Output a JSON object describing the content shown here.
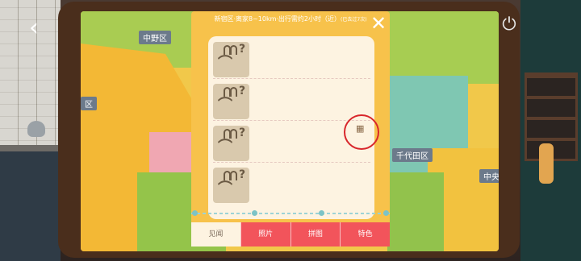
{
  "map": {
    "labels": [
      "中野区",
      "区",
      "千代田区",
      "中央"
    ]
  },
  "dialog": {
    "title": "新宿区·离家8~10km·出行需约2小时（近）",
    "title_note": "(已去过7次)",
    "close_glyph": "✕",
    "entries": [
      {
        "question": "?"
      },
      {
        "question": "?"
      },
      {
        "question": "?"
      },
      {
        "question": "?"
      }
    ],
    "tabs": [
      "见闻",
      "照片",
      "拼图",
      "特色"
    ]
  },
  "nav": {
    "back_glyph": "‹",
    "power_glyph": "⏻"
  },
  "colors": {
    "dialog_bg": "#f7c24b",
    "tab_red": "#f2545b",
    "panel_bg": "#fdf3e1",
    "annotation": "#d8262b"
  }
}
